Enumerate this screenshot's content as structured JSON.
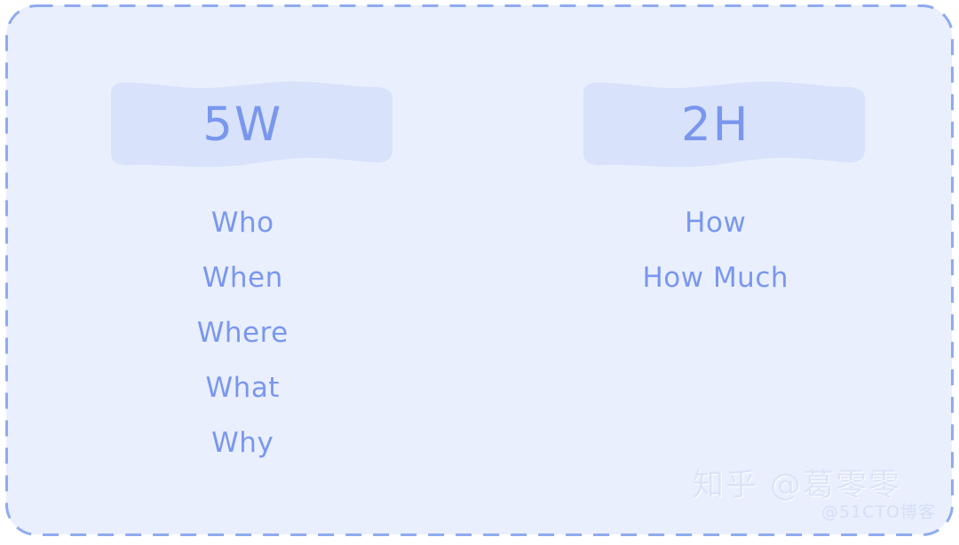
{
  "theme": {
    "page_background": "#ffffff",
    "panel_background": "#e9effd",
    "panel_border": "#8fabee",
    "badge_fill": "#d8e2fb",
    "text_color": "#7a97ee",
    "watermark_color": "#dbe4f8"
  },
  "panel": {
    "border_style": "dashed",
    "corner_radius": 34
  },
  "columns": [
    {
      "id": "5w",
      "badge": {
        "label": "5W",
        "icon": "highlight-wave-shape"
      },
      "items": [
        "Who",
        "When",
        "Where",
        "What",
        "Why"
      ]
    },
    {
      "id": "2h",
      "badge": {
        "label": "2H",
        "icon": "highlight-wave-shape"
      },
      "items": [
        "How",
        "How Much"
      ]
    }
  ],
  "watermarks": {
    "main": "知乎 @葛零零",
    "sub": "@51CTO博客"
  }
}
